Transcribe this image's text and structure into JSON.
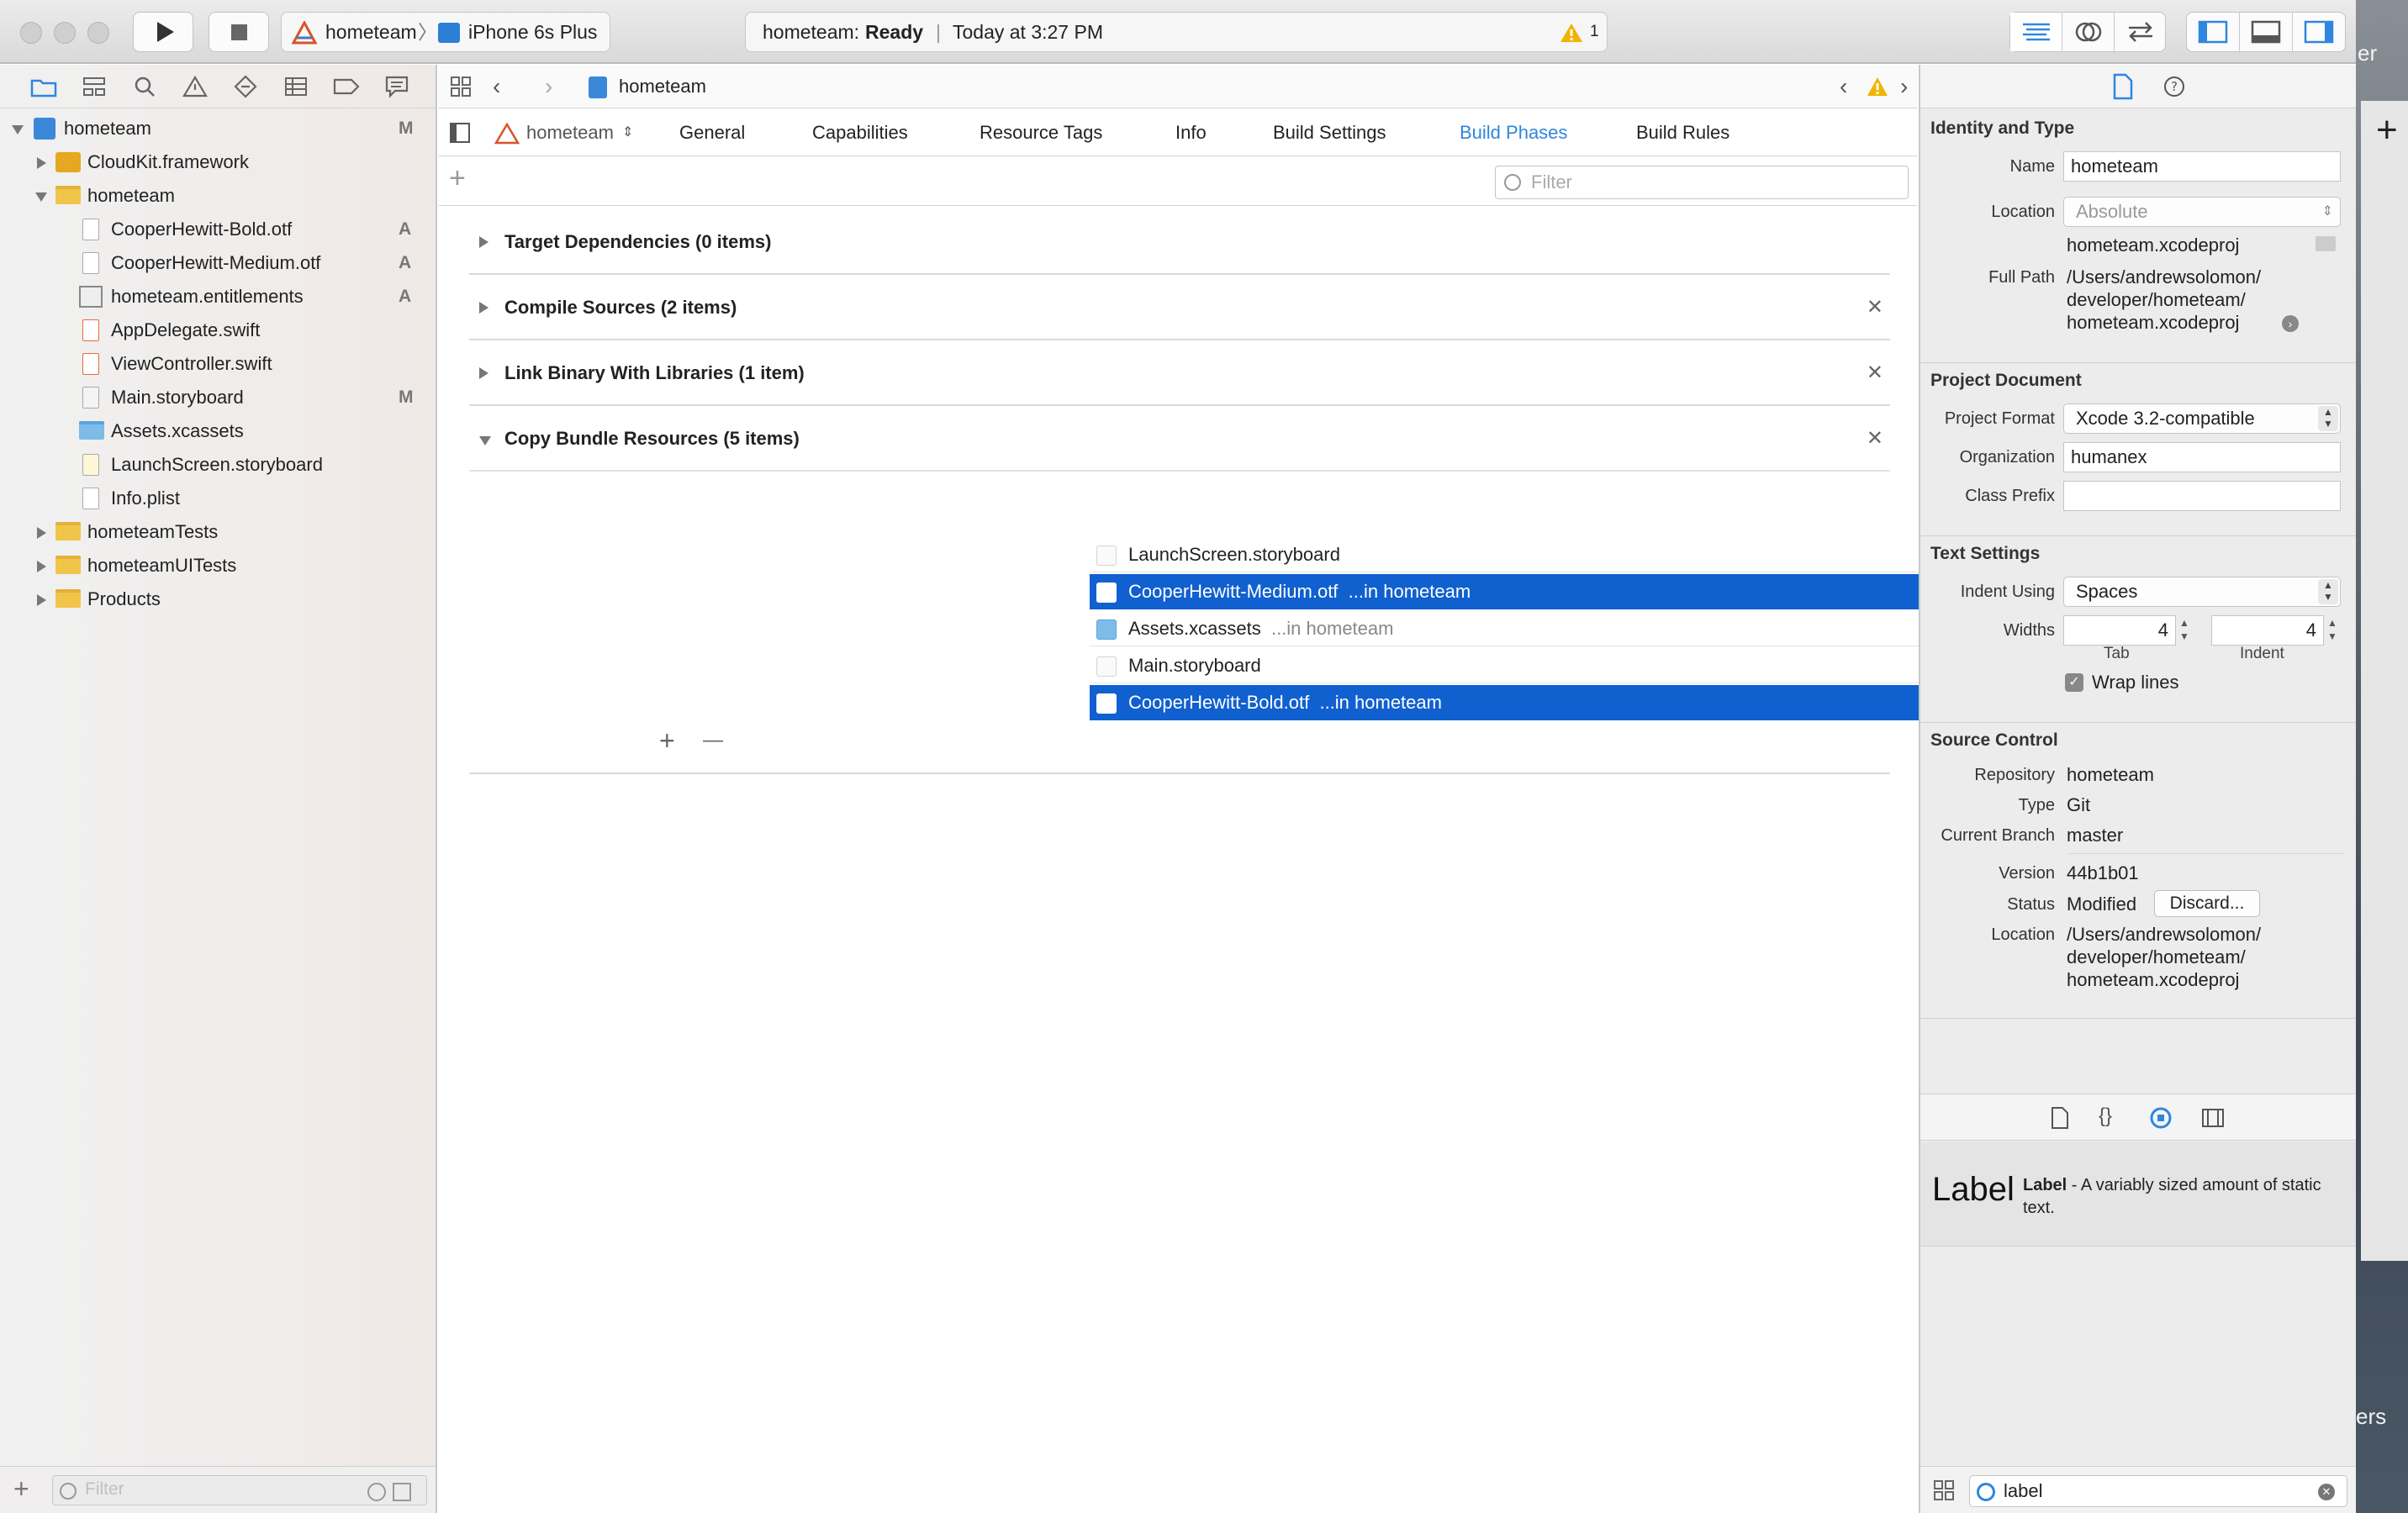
{
  "colors": {
    "accent": "#2f86df",
    "selection": "#1060d0",
    "warning": "#f0b400"
  },
  "toolbar": {
    "scheme": "hometeam",
    "destination": "iPhone 6s Plus",
    "activity_project": "hometeam:",
    "activity_status": "Ready",
    "activity_time": "Today at 3:27 PM",
    "warning_count": "1",
    "icons": [
      "run-icon",
      "stop-icon",
      "standard-editor-icon",
      "assistant-editor-icon",
      "version-editor-icon",
      "navigator-toggle-icon",
      "debug-area-toggle-icon",
      "utilities-toggle-icon"
    ]
  },
  "navigator": {
    "tabs": [
      "folder-icon",
      "symbol-icon",
      "search-icon",
      "warning-icon",
      "test-icon",
      "debug-icon",
      "breakpoint-icon",
      "report-icon"
    ],
    "items": [
      {
        "label": "hometeam",
        "status": "M",
        "kind": "project"
      },
      {
        "label": "CloudKit.framework",
        "status": "",
        "kind": "framework"
      },
      {
        "label": "hometeam",
        "status": "",
        "kind": "folder"
      },
      {
        "label": "CooperHewitt-Bold.otf",
        "status": "A",
        "kind": "otf"
      },
      {
        "label": "CooperHewitt-Medium.otf",
        "status": "A",
        "kind": "otf"
      },
      {
        "label": "hometeam.entitlements",
        "status": "A",
        "kind": "entitlements"
      },
      {
        "label": "AppDelegate.swift",
        "status": "",
        "kind": "swift"
      },
      {
        "label": "ViewController.swift",
        "status": "",
        "kind": "swift"
      },
      {
        "label": "Main.storyboard",
        "status": "M",
        "kind": "storyboard"
      },
      {
        "label": "Assets.xcassets",
        "status": "",
        "kind": "assets"
      },
      {
        "label": "LaunchScreen.storyboard",
        "status": "",
        "kind": "storyboard"
      },
      {
        "label": "Info.plist",
        "status": "",
        "kind": "plist"
      },
      {
        "label": "hometeamTests",
        "status": "",
        "kind": "folder"
      },
      {
        "label": "hometeamUITests",
        "status": "",
        "kind": "folder"
      },
      {
        "label": "Products",
        "status": "",
        "kind": "folder"
      }
    ],
    "filter_placeholder": "Filter"
  },
  "editor": {
    "breadcrumb": "hometeam",
    "target": "hometeam",
    "tabs": [
      "General",
      "Capabilities",
      "Resource Tags",
      "Info",
      "Build Settings",
      "Build Phases",
      "Build Rules"
    ],
    "active_tab": "Build Phases",
    "filter_placeholder": "Filter",
    "phases": [
      "Target Dependencies (0 items)",
      "Compile Sources (2 items)",
      "Link Binary With Libraries (1 item)",
      "Copy Bundle Resources (5 items)"
    ],
    "resources": [
      {
        "name": "LaunchScreen.storyboard",
        "location": "",
        "selected": false
      },
      {
        "name": "CooperHewitt-Medium.otf",
        "location": "...in hometeam",
        "selected": true
      },
      {
        "name": "Assets.xcassets",
        "location": "...in hometeam",
        "selected": false
      },
      {
        "name": "Main.storyboard",
        "location": "",
        "selected": false
      },
      {
        "name": "CooperHewitt-Bold.otf",
        "location": "...in hometeam",
        "selected": true
      }
    ],
    "add_symbol": "+",
    "remove_symbol": "—"
  },
  "inspector": {
    "identity": {
      "title": "Identity and Type",
      "name_label": "Name",
      "name": "hometeam",
      "location_label": "Location",
      "location": "Absolute",
      "file": "hometeam.xcodeproj",
      "fullpath_label": "Full Path",
      "fullpath": [
        "/Users/andrewsolomon/",
        "developer/hometeam/",
        "hometeam.xcodeproj"
      ]
    },
    "project_document": {
      "title": "Project Document",
      "format_label": "Project Format",
      "format": "Xcode 3.2-compatible",
      "org_label": "Organization",
      "org": "humanex",
      "prefix_label": "Class Prefix",
      "prefix": ""
    },
    "text_settings": {
      "title": "Text Settings",
      "indent_label": "Indent Using",
      "indent": "Spaces",
      "widths_label": "Widths",
      "tab_value": "4",
      "indent_value": "4",
      "tab_caption": "Tab",
      "indent_caption": "Indent",
      "wrap": "Wrap lines"
    },
    "source_control": {
      "title": "Source Control",
      "repo_label": "Repository",
      "repo": "hometeam",
      "type_label": "Type",
      "type": "Git",
      "branch_label": "Current Branch",
      "branch": "master",
      "version_label": "Version",
      "version": "44b1b01",
      "status_label": "Status",
      "status": "Modified",
      "discard": "Discard...",
      "location_label": "Location",
      "location": [
        "/Users/andrewsolomon/",
        "developer/hometeam/",
        "hometeam.xcodeproj"
      ]
    },
    "library": {
      "item_big": "Label",
      "item_title": "Label",
      "item_desc": " - A variably sized amount of static text.",
      "search": "label"
    }
  },
  "desktop": {
    "top_text": "er",
    "bottom_text": "ers"
  }
}
